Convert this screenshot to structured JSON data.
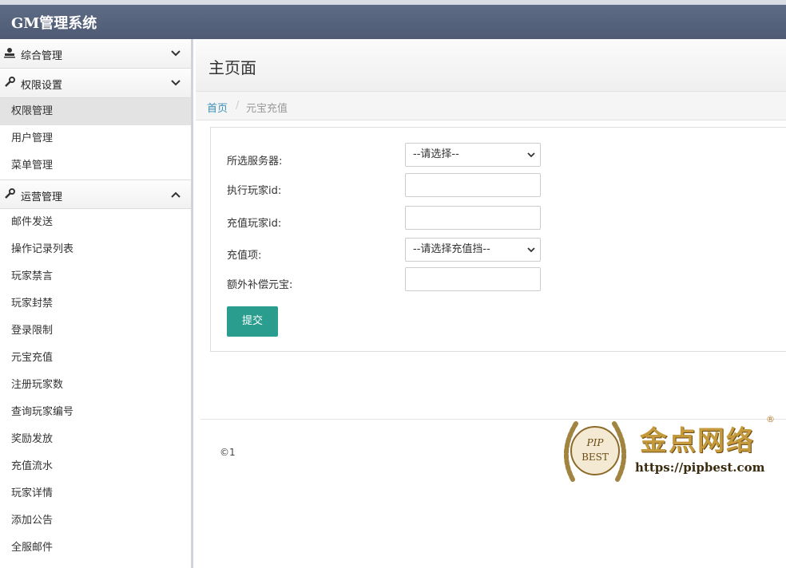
{
  "app": {
    "title": "GM管理系统"
  },
  "sidebar": {
    "groups": [
      {
        "label": "综合管理",
        "icon": "user-icon",
        "expanded": false,
        "items": []
      },
      {
        "label": "权限设置",
        "icon": "wrench-icon",
        "expanded": false,
        "items": [
          "权限管理",
          "用户管理",
          "菜单管理"
        ]
      },
      {
        "label": "运营管理",
        "icon": "wrench-icon",
        "expanded": true,
        "items": [
          "邮件发送",
          "操作记录列表",
          "玩家禁言",
          "玩家封禁",
          "登录限制",
          "元宝充值",
          "注册玩家数",
          "查询玩家编号",
          "奖励发放",
          "充值流水",
          "玩家详情",
          "添加公告",
          "全服邮件"
        ]
      }
    ]
  },
  "page": {
    "title": "主页面",
    "breadcrumb": {
      "home": "首页",
      "separator": "/",
      "current": "元宝充值"
    }
  },
  "form": {
    "server_label": "所选服务器:",
    "server_selected": "--请选择--",
    "exec_player_label": "执行玩家id:",
    "exec_player_value": "",
    "recharge_player_label": "充值玩家id:",
    "recharge_player_value": "",
    "recharge_item_label": "充值项:",
    "recharge_item_selected": "--请选择充值挡--",
    "extra_label": "额外补偿元宝:",
    "extra_value": "",
    "submit_label": "提交"
  },
  "footer": {
    "copyright": "©1"
  },
  "watermark": {
    "logo_text": "金点网络",
    "url": "https://pipbest.com",
    "mark": "®",
    "badge": "PIP BEST"
  },
  "colors": {
    "header": "#56627b",
    "accent": "#2a9d8f",
    "link": "#3a8fb7"
  }
}
